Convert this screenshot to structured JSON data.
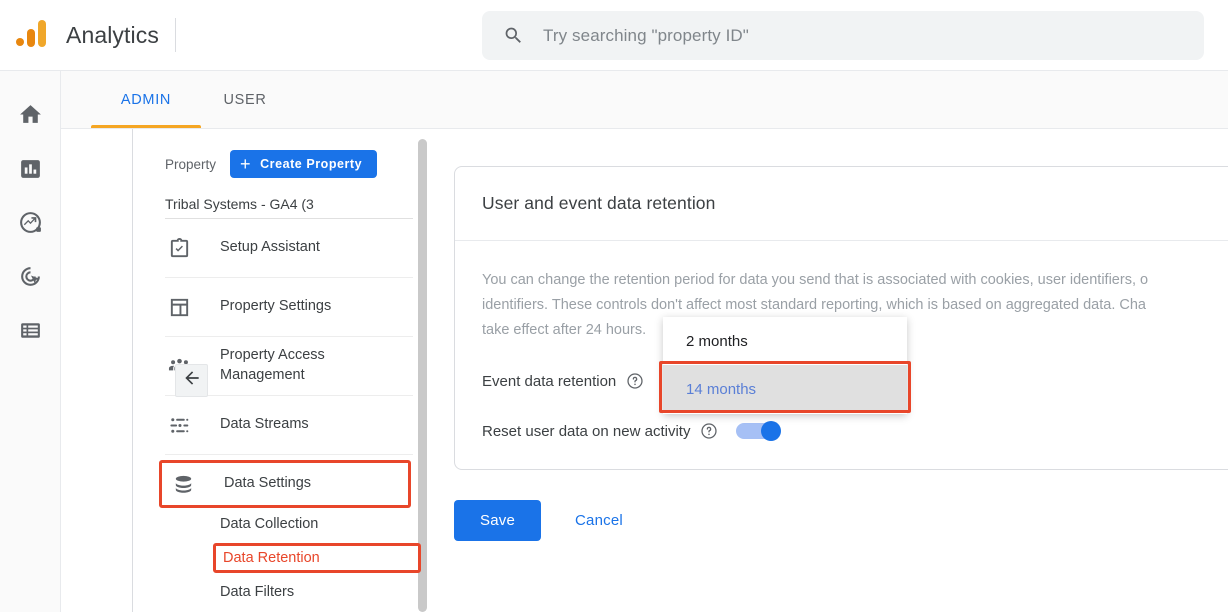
{
  "header": {
    "brand": "Analytics",
    "logo_icon": "google-analytics-logo",
    "accent_orange": "#e8870f",
    "accent_blue": "#1a73e8"
  },
  "search": {
    "icon": "search-icon",
    "placeholder": "Try searching \"property ID\"",
    "value": ""
  },
  "rail": {
    "items": [
      {
        "icon": "home-icon",
        "name": "home"
      },
      {
        "icon": "reports-bar-chart-icon",
        "name": "reports"
      },
      {
        "icon": "explore-trending-icon",
        "name": "explore"
      },
      {
        "icon": "advertising-target-icon",
        "name": "advertising"
      },
      {
        "icon": "configure-list-icon",
        "name": "configure"
      }
    ]
  },
  "tabs": [
    {
      "label": "ADMIN",
      "active": true
    },
    {
      "label": "USER",
      "active": false
    }
  ],
  "nav": {
    "back_icon": "arrow-left-icon",
    "property_label": "Property",
    "create_button": "Create Property",
    "create_button_icon": "plus-icon",
    "property_name": "Tribal Systems - GA4 (3",
    "menu": [
      {
        "label": "Setup Assistant",
        "icon": "clipboard-check-icon",
        "highlight": false
      },
      {
        "label": "Property Settings",
        "icon": "layout-panel-icon",
        "highlight": false
      },
      {
        "label": "Property Access Management",
        "icon": "people-group-icon",
        "highlight": false
      },
      {
        "label": "Data Streams",
        "icon": "data-streams-icon",
        "highlight": false
      },
      {
        "label": "Data Settings",
        "icon": "database-stack-icon",
        "highlight": true
      }
    ],
    "submenu": [
      {
        "label": "Data Collection",
        "highlight": false
      },
      {
        "label": "Data Retention",
        "highlight": true
      },
      {
        "label": "Data Filters",
        "highlight": false
      }
    ],
    "highlight_color": "#e8462a"
  },
  "card": {
    "title": "User and event data retention",
    "description": "You can change the retention period for data you send that is associated with cookies, user identifiers, o\nidentifiers. These controls don't affect most standard reporting, which is based on aggregated data. Cha\ntake effect after 24 hours.",
    "event_retention_label": "Event data retention",
    "event_retention_help_icon": "help-circle-icon",
    "reset_label": "Reset user data on new activity",
    "reset_help_icon": "help-circle-icon",
    "reset_toggle_on": true
  },
  "dropdown": {
    "open": true,
    "options": [
      {
        "label": "2 months",
        "selected": false
      },
      {
        "label": "14 months",
        "selected": true
      }
    ],
    "highlighted_option": "14 months"
  },
  "actions": {
    "save_label": "Save",
    "cancel_label": "Cancel"
  }
}
